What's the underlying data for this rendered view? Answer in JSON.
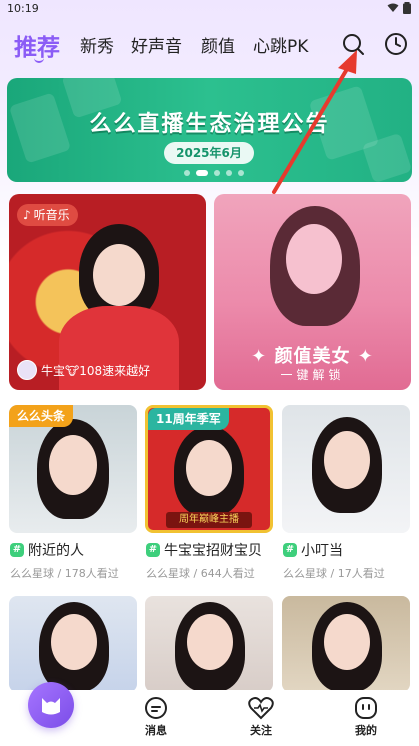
{
  "status_bar": {
    "time": "10:19"
  },
  "top_nav": {
    "tabs": [
      {
        "label": "推荐",
        "active": true
      },
      {
        "label": "新秀"
      },
      {
        "label": "好声音"
      },
      {
        "label": "颜值"
      },
      {
        "label": "心跳PK"
      }
    ],
    "icons": [
      "search-icon",
      "history-clock-icon"
    ],
    "accent_color": "#8b5cf6"
  },
  "banner": {
    "title": "么么直播生态治理公告",
    "date": "2025年6月",
    "slides": 5,
    "active_slide": 2
  },
  "featured": {
    "music_badge": "听音乐",
    "live_user": "牛宝🐮108速来越好",
    "unlock_title": "✦ 颜值美女 ✦",
    "unlock_sub": "一键解锁"
  },
  "grid": [
    {
      "tag": "么么头条",
      "title": "附近的人",
      "meta": "么么星球 / 178人看过"
    },
    {
      "tag": "11周年季军",
      "title": "牛宝宝招财宝贝",
      "meta": "么么星球 / 644人看过",
      "frame_text": "周年巅峰主播"
    },
    {
      "title": "小叮当",
      "meta": "么么星球 / 17人看过"
    }
  ],
  "grid_hash": "#",
  "bottom_nav": {
    "items": [
      {
        "label": "消息"
      },
      {
        "label": "关注"
      },
      {
        "label": "我的"
      }
    ]
  }
}
